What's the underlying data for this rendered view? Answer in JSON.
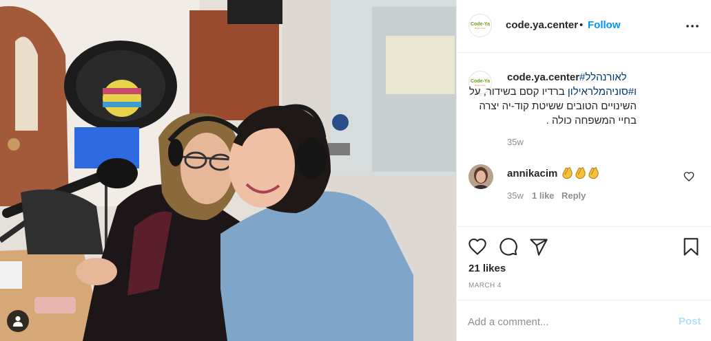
{
  "post": {
    "author": "code.ya.center",
    "follow_separator": "•",
    "follow_label": "Follow",
    "more_icon": "more-horizontal-icon",
    "logo_text": "Code-Ya",
    "logo_sub": "Begin today"
  },
  "caption": {
    "username": "code.ya.center",
    "hashtag_1": "#לאורנהלל",
    "hashtag_2": "ו#סוניהמלראילון",
    "line_2_rest": " ברדיו קסם בשידור, על",
    "line_3": "השינויים הטובים ששיטת קוד-יה יצרה",
    "line_4": "בחיי המשפחה כולה .",
    "time": "35w"
  },
  "comment": {
    "username": "annikacim",
    "emoji": "clapping-hands-emoji x3",
    "time": "35w",
    "likes": "1 like",
    "reply_label": "Reply",
    "heart_icon": "heart-outline-icon"
  },
  "actions": {
    "like_icon": "heart-icon",
    "comment_icon": "comment-icon",
    "share_icon": "send-icon",
    "save_icon": "bookmark-icon"
  },
  "likes_text": "21 likes",
  "date_text": "MARCH 4",
  "add_comment": {
    "placeholder": "Add a comment...",
    "post_label": "Post"
  },
  "colors": {
    "accent": "#0095f6",
    "post_disabled": "#b2dffc",
    "secondary_text": "#8e8e8e",
    "hashtag": "#00376b"
  }
}
